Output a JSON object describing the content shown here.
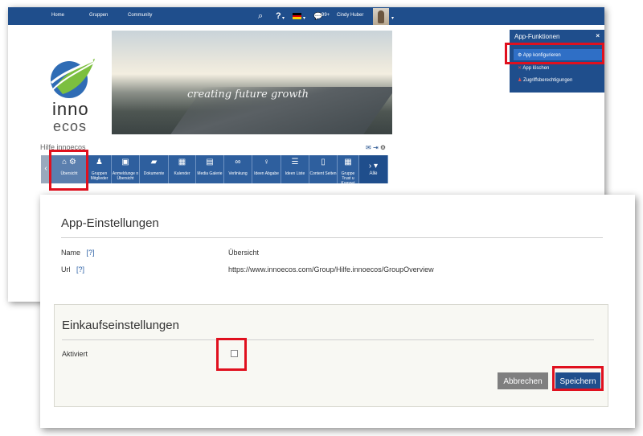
{
  "topnav": {
    "home": "Home",
    "gruppen": "Gruppen",
    "community": "Community",
    "notifications": "99+",
    "user": "Cindy Huber"
  },
  "logo": {
    "line1": "inno",
    "line2": "ecos"
  },
  "banner": {
    "text": "creating future growth"
  },
  "group": {
    "title": "Hilfe innoecos"
  },
  "tabs": [
    {
      "label": "Übersicht",
      "icon": "house-icon"
    },
    {
      "label": "Gruppen Mitglieder",
      "icon": "members-icon"
    },
    {
      "label": "Anmeldunge n Übersicht",
      "icon": "registration-icon"
    },
    {
      "label": "Dokumente",
      "icon": "folder-icon"
    },
    {
      "label": "Kalender",
      "icon": "calendar-icon"
    },
    {
      "label": "Media Galerie",
      "icon": "gallery-icon"
    },
    {
      "label": "Verlinkung",
      "icon": "link-icon"
    },
    {
      "label": "Ideen Abgabe",
      "icon": "bulb-icon"
    },
    {
      "label": "Ideen Liste",
      "icon": "list-icon"
    },
    {
      "label": "Content Seiten",
      "icon": "page-icon"
    },
    {
      "label": "Gruppe Trust u Kompet",
      "icon": "grid-icon"
    }
  ],
  "tab_all": "Alle",
  "app_panel": {
    "title": "App-Funktionen",
    "close": "×",
    "items": [
      "App konfigurieren",
      "App löschen",
      "Zugriffsberechtigungen"
    ]
  },
  "dialog": {
    "title": "App-Einstellungen",
    "help_mark": "[?]",
    "name_label": "Name",
    "name_value": "Übersicht",
    "url_label": "Url",
    "url_value": "https://www.innoecos.com/Group/Hilfe.innoecos/GroupOverview",
    "section_title": "Einkaufseinstellungen",
    "aktiviert_label": "Aktiviert",
    "aktiviert_checked": false,
    "cancel": "Abbrechen",
    "save": "Speichern"
  },
  "colors": {
    "primary": "#1f4e8c",
    "highlight": "#e0101e",
    "section_bg": "#f8f8f3"
  }
}
